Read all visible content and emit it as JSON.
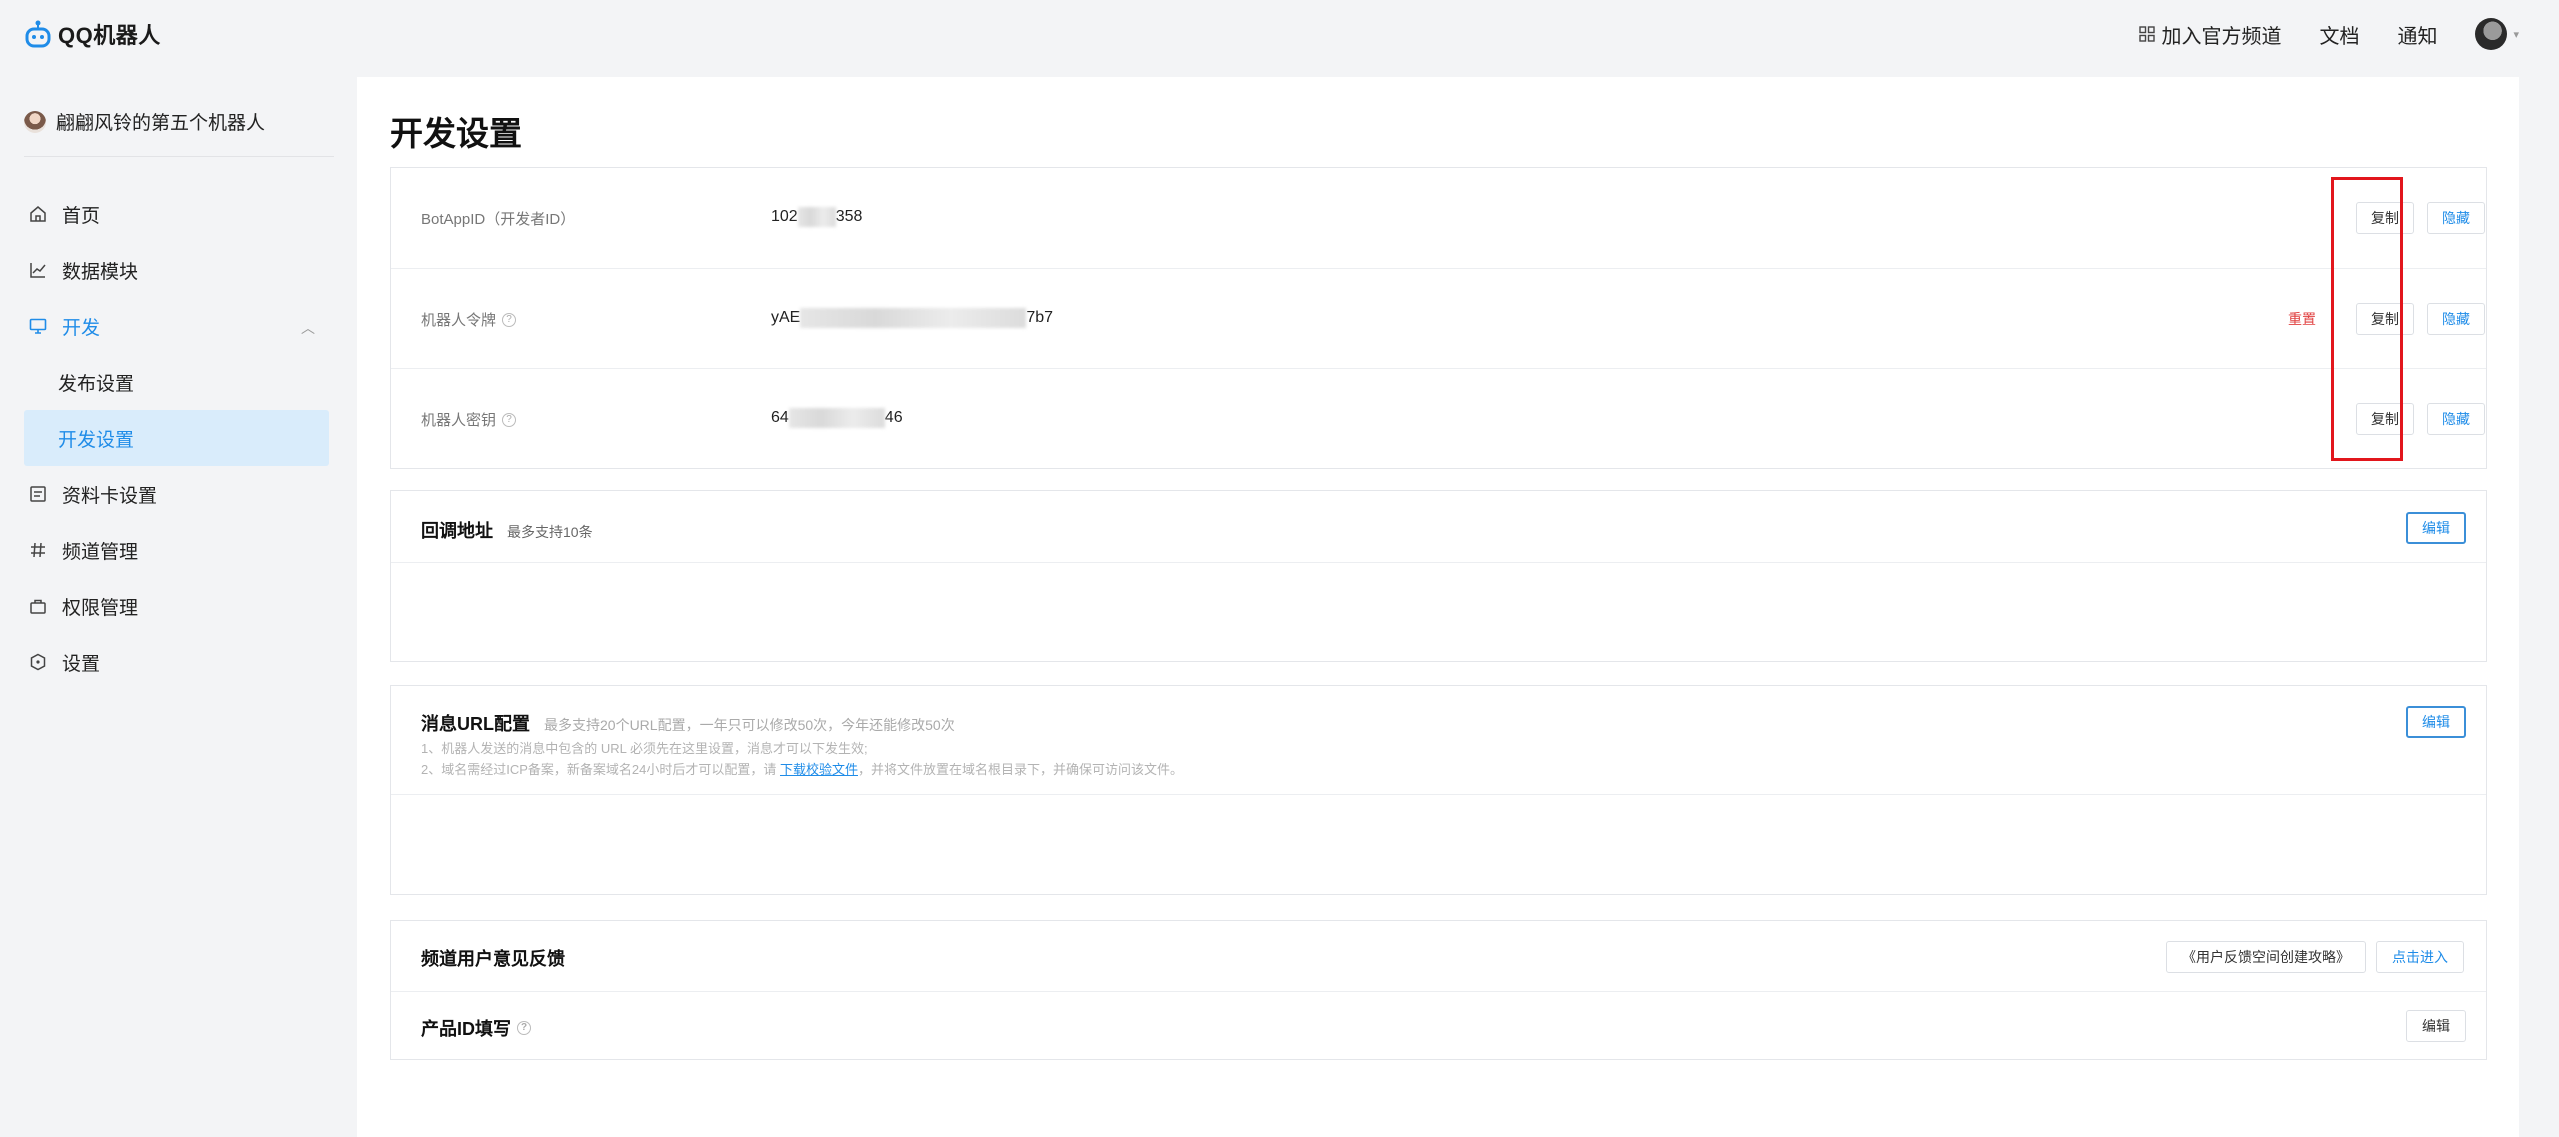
{
  "app": {
    "logo_text": "QQ机器人"
  },
  "topbar": {
    "join_channel": "加入官方频道",
    "docs": "文档",
    "notify": "通知"
  },
  "sidebar": {
    "bot_name": "翩翩风铃的第五个机器人",
    "items": [
      {
        "label": "首页",
        "icon": "home-icon"
      },
      {
        "label": "数据模块",
        "icon": "chart-line-icon"
      },
      {
        "label": "开发",
        "icon": "monitor-icon"
      },
      {
        "label": "发布设置"
      },
      {
        "label": "开发设置"
      },
      {
        "label": "资料卡设置",
        "icon": "card-icon"
      },
      {
        "label": "频道管理",
        "icon": "hash-icon"
      },
      {
        "label": "权限管理",
        "icon": "bag-icon"
      },
      {
        "label": "设置",
        "icon": "hexagon-icon"
      }
    ]
  },
  "main": {
    "title": "开发设置",
    "credentials": [
      {
        "label": "BotAppID（开发者ID）",
        "value_prefix": "102",
        "value_suffix": "358",
        "copy": "复制",
        "hide": "隐藏"
      },
      {
        "label": "机器人令牌",
        "value_prefix": "yAE",
        "value_suffix": "7b7",
        "reset": "重置",
        "copy": "复制",
        "hide": "隐藏"
      },
      {
        "label": "机器人密钥",
        "value_prefix": "64",
        "value_suffix": "46",
        "copy": "复制",
        "hide": "隐藏"
      }
    ],
    "callback": {
      "title": "回调地址",
      "hint": "最多支持10条",
      "edit": "编辑"
    },
    "msg_url": {
      "title": "消息URL配置",
      "hint": "最多支持20个URL配置，一年只可以修改50次，今年还能修改50次",
      "note1": "1、机器人发送的消息中包含的 URL 必须先在这里设置，消息才可以下发生效;",
      "note2_pre": "2、域名需经过ICP备案，新备案域名24小时后才可以配置，请 ",
      "note2_link": "下载校验文件",
      "note2_post": "，并将文件放置在域名根目录下，并确保可访问该文件。",
      "edit": "编辑"
    },
    "feedback": {
      "title": "频道用户意见反馈",
      "guide": "《用户反馈空间创建攻略》",
      "enter": "点击进入"
    },
    "product": {
      "title": "产品ID填写",
      "edit": "编辑"
    }
  },
  "colors": {
    "accent": "#1f8ce8",
    "danger": "#e04040",
    "highlight_box": "#e2161c",
    "selected_bg": "#d9ecfb"
  }
}
